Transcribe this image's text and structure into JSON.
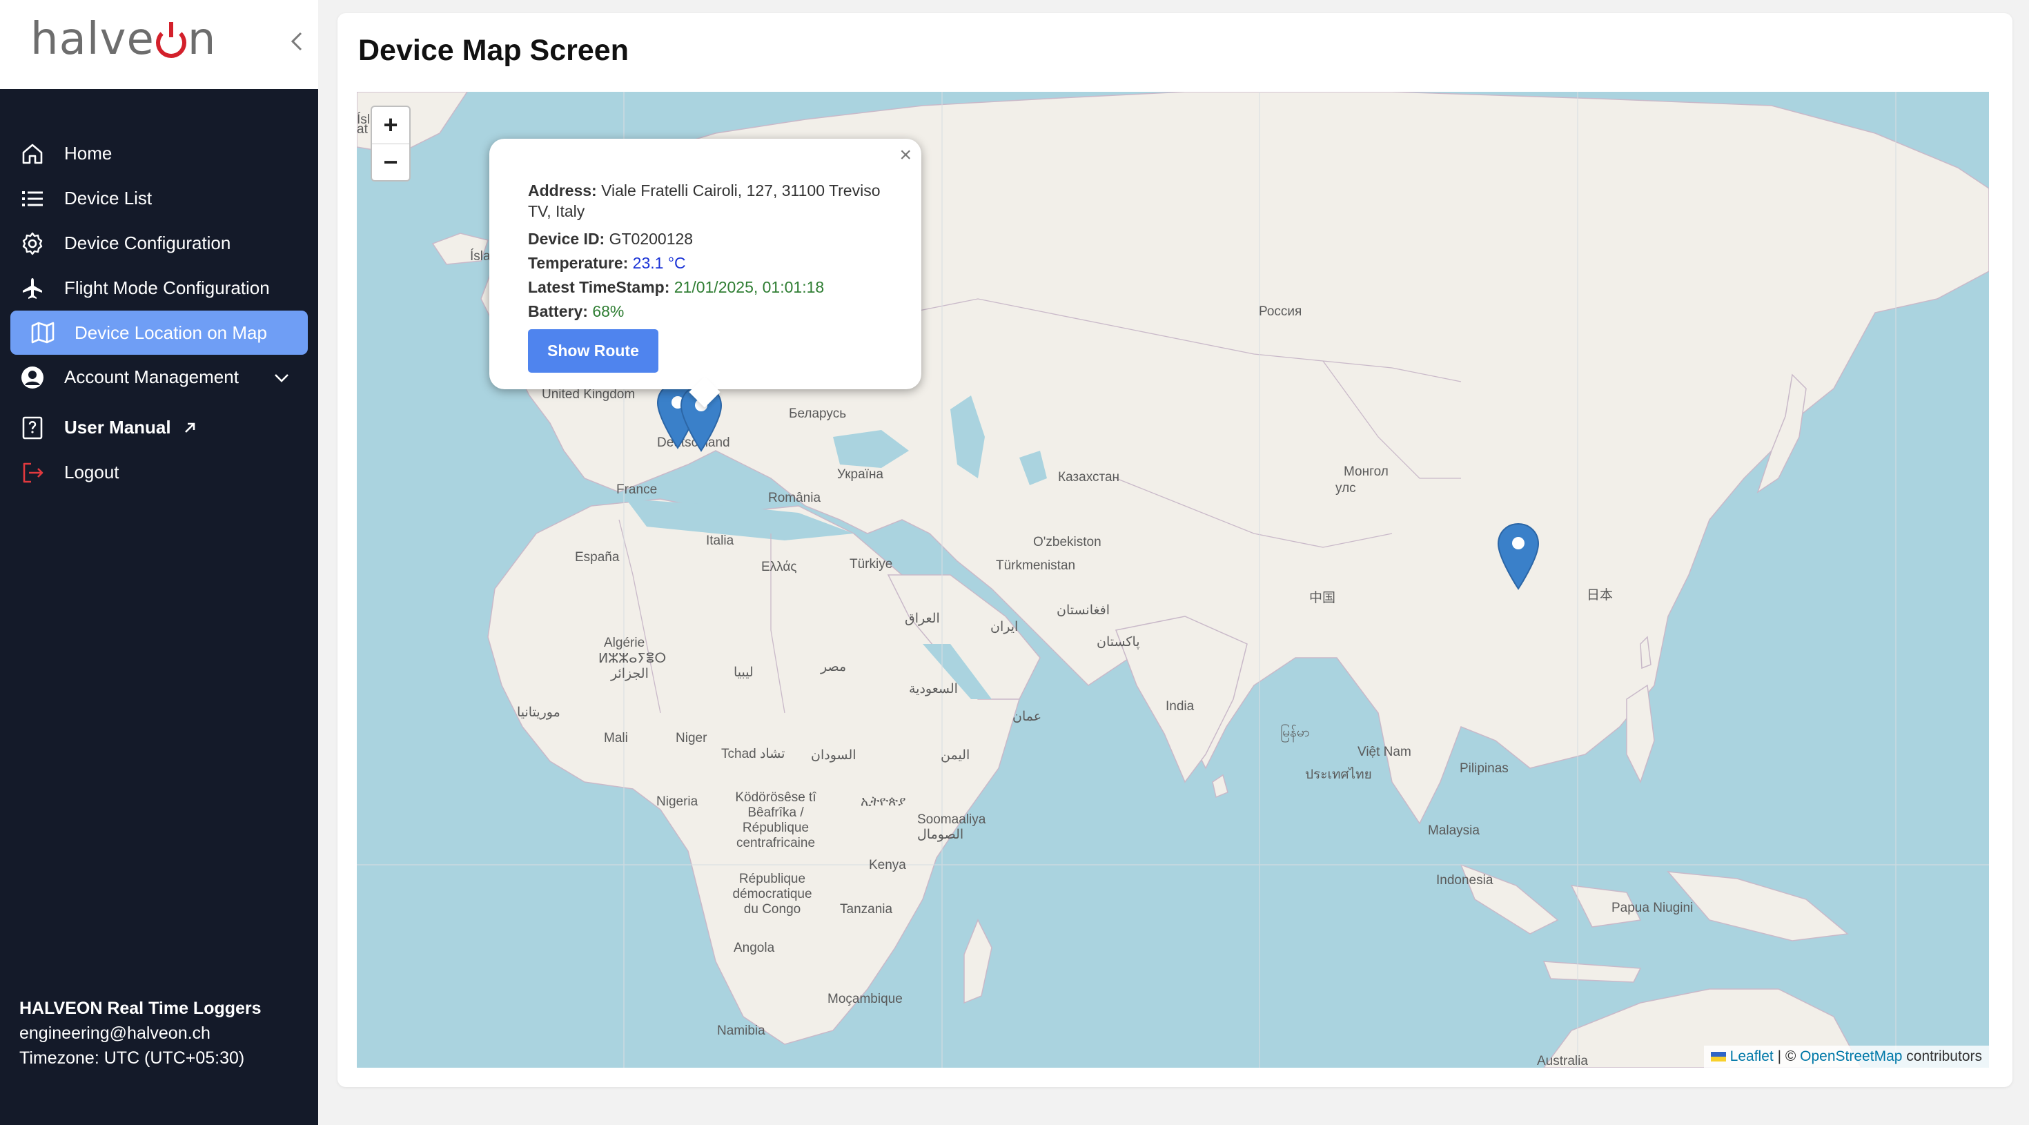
{
  "app": {
    "logo_text": "halveon"
  },
  "sidebar": {
    "items": [
      {
        "label": "Home"
      },
      {
        "label": "Device List"
      },
      {
        "label": "Device Configuration"
      },
      {
        "label": "Flight Mode Configuration"
      },
      {
        "label": "Device Location on Map",
        "active": true
      },
      {
        "label": "Account Management"
      },
      {
        "label": "User Manual"
      },
      {
        "label": "Logout"
      }
    ],
    "footer": {
      "brand": "HALVEON Real Time Loggers",
      "email": "engineering@halveon.ch",
      "timezone": "Timezone: UTC (UTC+05:30)"
    }
  },
  "main": {
    "title": "Device Map Screen"
  },
  "map": {
    "zoom_in": "+",
    "zoom_out": "−",
    "labels": [
      "Россия",
      "United Kingdom",
      "Беларусь",
      "Deutschland",
      "Україна",
      "France",
      "România",
      "Казахстан",
      "Монгол",
      "улс",
      "Italia",
      "España",
      "Ελλάς",
      "Türkiye",
      "O'zbekiston",
      "Türkmenistan",
      "中国",
      "日本",
      "Algérie",
      "ⵍⵣⵣⴰⵢⴻⵔ",
      "الجزائر",
      "ليبيا",
      "مصر",
      "العراق",
      "ایران",
      "افغانستان",
      "پاکستان",
      "السعودية",
      "India",
      "موريتانيا",
      "Mali",
      "Niger",
      "Tchad تشاد",
      "السودان",
      "عمان",
      "اليمن",
      "မြန်မာ",
      "Việt Nam",
      "ประเทศไทย",
      "Pilipinas",
      "Nigeria",
      "Ködörösêse tî Bêafrîka / République centrafricaine",
      "ኢትዮጵያ",
      "Soomaaliya الصومال",
      "Malaysia",
      "Kenya",
      "Indonesia",
      "République démocratique du Congo",
      "Tanzania",
      "Papua Niugini",
      "Angola",
      "Moçambique",
      "Namibia",
      "Australia",
      "Ísla",
      "Ísl",
      "at"
    ],
    "attribution": {
      "leaflet": "Leaflet",
      "sep": "| ©",
      "osm": "OpenStreetMap",
      "suffix": "contributors"
    }
  },
  "popup": {
    "address_label": "Address:",
    "address_value": "Viale Fratelli Cairoli, 127, 31100 Treviso TV, Italy",
    "device_label": "Device ID:",
    "device_value": "GT0200128",
    "temp_label": "Temperature:",
    "temp_value": "23.1 °C",
    "ts_label": "Latest TimeStamp:",
    "ts_value": "21/01/2025, 01:01:18",
    "battery_label": "Battery:",
    "battery_value": "68%",
    "button": "Show Route",
    "close": "×"
  },
  "colors": {
    "sidebar_bg": "#141a29",
    "active_bg": "#6f9ef5",
    "water": "#aad3df",
    "land": "#f2efe9",
    "marker": "#3a80c9",
    "button": "#4f84ee"
  }
}
